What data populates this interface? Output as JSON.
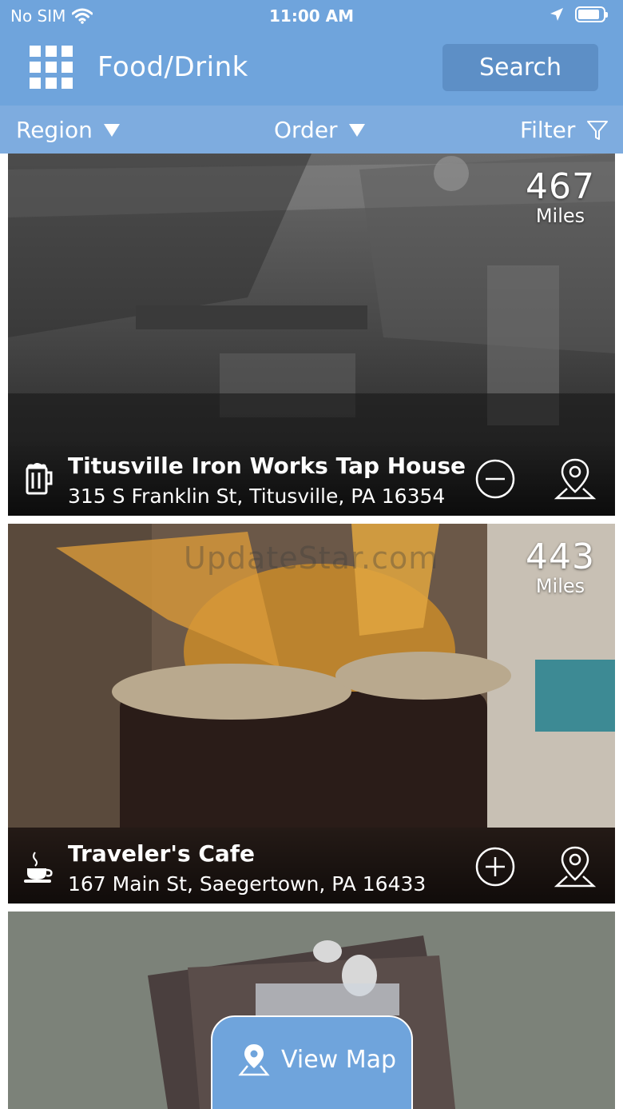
{
  "status_bar": {
    "carrier": "No SIM",
    "time": "11:00 AM",
    "battery_level": 0.85
  },
  "header": {
    "title": "Food/Drink",
    "search_label": "Search"
  },
  "filters": {
    "region": "Region",
    "order": "Order",
    "filter": "Filter"
  },
  "listings": [
    {
      "name": "Titusville Iron Works Tap House",
      "address": "315 S Franklin St, Titusville, PA 16354",
      "distance": "467",
      "distance_unit": "Miles",
      "category_icon": "beer-mug-icon",
      "action": "remove"
    },
    {
      "name": "Traveler's Cafe",
      "address": "167 Main St, Saegertown, PA 16433",
      "distance": "443",
      "distance_unit": "Miles",
      "category_icon": "coffee-cup-icon",
      "action": "add"
    },
    {
      "name": "",
      "address": "",
      "distance": "",
      "distance_unit": "",
      "category_icon": "",
      "action": ""
    }
  ],
  "watermark": "UpdateStar.com",
  "view_map": {
    "label": "View Map"
  },
  "colors": {
    "header": "#6fa4dc",
    "filter_bar": "#7eacdf",
    "search_button": "#5d8fc6"
  }
}
